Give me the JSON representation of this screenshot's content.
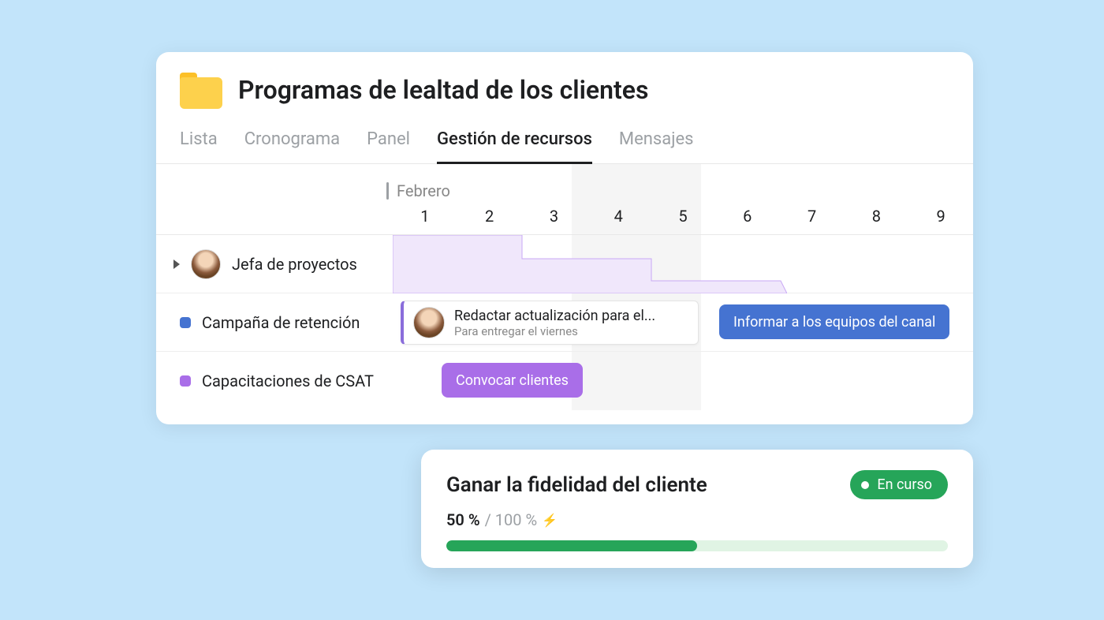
{
  "header": {
    "title": "Programas de lealtad de los clientes"
  },
  "tabs": [
    {
      "label": "Lista",
      "active": false
    },
    {
      "label": "Cronograma",
      "active": false
    },
    {
      "label": "Panel",
      "active": false
    },
    {
      "label": "Gestión de recursos",
      "active": true
    },
    {
      "label": "Mensajes",
      "active": false
    }
  ],
  "timeline": {
    "month": "Febrero",
    "days": [
      "1",
      "2",
      "3",
      "4",
      "5",
      "6",
      "7",
      "8",
      "9"
    ],
    "rows": [
      {
        "label": "Jefa de proyectos",
        "kind": "person"
      },
      {
        "label": "Campaña de retención",
        "kind": "category",
        "color": "#4573d1"
      },
      {
        "label": "Capacitaciones de CSAT",
        "kind": "category",
        "color": "#a96ee8"
      }
    ],
    "task_card": {
      "title": "Redactar actualización para el...",
      "subtitle": "Para entregar el viernes"
    },
    "pills": {
      "blue": "Informar a los equipos del canal",
      "purple": "Convocar clientes"
    }
  },
  "goal": {
    "title": "Ganar la fidelidad del cliente",
    "status": "En curso",
    "current": "50 %",
    "total": "/ 100 %",
    "progress_pct": 50
  },
  "colors": {
    "blue": "#4573d1",
    "purple": "#a96ee8",
    "green": "#26a559",
    "capacity_fill": "#f0e7fb",
    "capacity_stroke": "#c9a8f5"
  }
}
